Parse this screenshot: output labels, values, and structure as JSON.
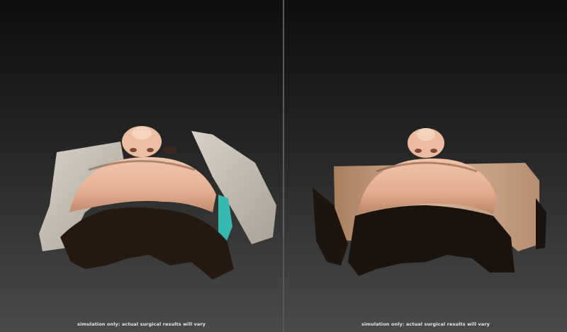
{
  "views": [
    {
      "id": "before",
      "disclaimer": "simulation only: actual surgical results will vary",
      "colors": {
        "skin": "#e8b79a",
        "skin_shadow": "#b98266",
        "hair": "#2a1c14",
        "garment": "#c9c2b6",
        "accent": "#35b8b0"
      }
    },
    {
      "id": "after",
      "disclaimer": "simulation only: actual surgical results will vary",
      "colors": {
        "skin": "#e6b496",
        "skin_shadow": "#b07e60",
        "hair": "#201610",
        "garment": "#c9a487",
        "accent": ""
      }
    }
  ]
}
